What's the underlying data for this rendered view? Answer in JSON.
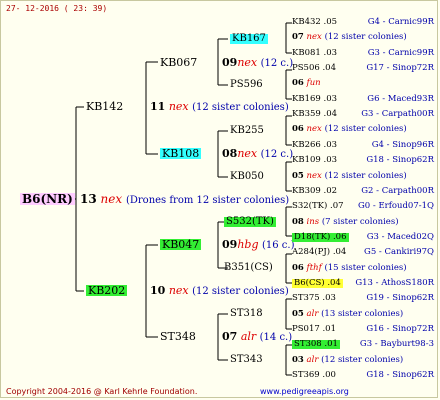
{
  "header": {
    "date": "27- 12-2016 ( 23: 39)"
  },
  "root": {
    "id": "B6(NR)",
    "gen": "13",
    "marking": "nex",
    "note": "(Drones from 12 sister colonies)"
  },
  "level1": {
    "a": {
      "id": "KB142",
      "gen": "11",
      "marking": "nex",
      "note": "(12 sister colonies)"
    },
    "b": {
      "id": "KB202",
      "gen": "10",
      "marking": "nex",
      "note": "(12 sister colonies)"
    }
  },
  "level2": {
    "a1": {
      "id": "KB067",
      "gen": "09",
      "marking": "nex",
      "note": "(12 c.)"
    },
    "a2": {
      "id": "KB108",
      "gen": "08",
      "marking": "nex",
      "note": "(12 c.)"
    },
    "b1": {
      "id": "KB047",
      "gen": "09",
      "marking": "hbg",
      "note": "(16 c.)"
    },
    "b2": {
      "id": "ST348",
      "gen": "07",
      "marking": "alr",
      "note": "(14 c.)"
    }
  },
  "level3": {
    "a1s": "KB167",
    "a1d": "PS596",
    "a2s": "KB255",
    "a2d": "KB050",
    "b1s": "S532(TK)",
    "b1d": "B351(CS)",
    "b2s": "ST318",
    "b2d": "ST343"
  },
  "leaves": [
    {
      "left": "KB432 .05",
      "right": "G4 - Carnic99R"
    },
    {
      "gen": "07",
      "mark": "nex",
      "note": "(12 sister colonies)"
    },
    {
      "left": "KB081 .03",
      "right": "G3 - Carnic99R"
    },
    {
      "left": "PS506 .04",
      "right": "G17 - Sinop72R"
    },
    {
      "gen": "06",
      "mark": "fun",
      "note": ""
    },
    {
      "left": "KB169 .03",
      "right": "G6 - Maced93R"
    },
    {
      "left": "KB359 .04",
      "right": "G3 - Carpath00R"
    },
    {
      "gen": "06",
      "mark": "nex",
      "note": "(12 sister colonies)"
    },
    {
      "left": "KB266 .03",
      "right": "G4 - Sinop96R"
    },
    {
      "left": "KB109 .03",
      "right": "G18 - Sinop62R"
    },
    {
      "gen": "05",
      "mark": "nex",
      "note": "(12 sister colonies)"
    },
    {
      "left": "KB309 .02",
      "right": "G2 - Carpath00R"
    },
    {
      "left": "S32(TK) .07",
      "right": "G0 - Erfoud07-1Q"
    },
    {
      "gen": "08",
      "mark": "ins",
      "note": "(7 sister colonies)"
    },
    {
      "left": "D18(TK) .06",
      "right": "G3 - Maced02Q"
    },
    {
      "left": "A284(PJ) .04",
      "right": "G5 - Cankiri97Q"
    },
    {
      "gen": "06",
      "mark": "fthf",
      "note": "(15 sister colonies)"
    },
    {
      "left": "B6(CS) .04",
      "right": "G13 - AthosS180R"
    },
    {
      "left": "ST375 .03",
      "right": "G19 - Sinop62R"
    },
    {
      "gen": "05",
      "mark": "alr",
      "note": "(13 sister colonies)"
    },
    {
      "left": "PS017 .01",
      "right": "G16 - Sinop72R"
    },
    {
      "left": "ST308 .01",
      "right": "G3 - Bayburt98-3"
    },
    {
      "gen": "03",
      "mark": "alr",
      "note": "(12 sister colonies)"
    },
    {
      "left": "ST369 .00",
      "right": "G18 - Sinop62R"
    }
  ],
  "footer": {
    "copyright": "Copyright 2004-2016 @ Karl Kehrle Foundation.",
    "url": "www.pedigreeapis.org"
  }
}
